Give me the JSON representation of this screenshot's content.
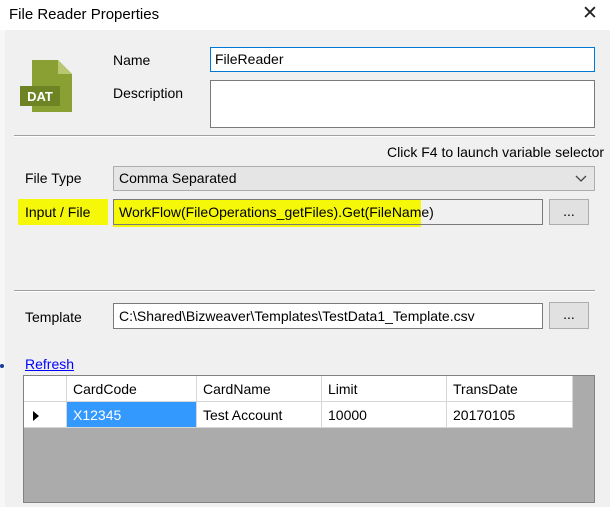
{
  "window": {
    "title": "File Reader Properties"
  },
  "icon": {
    "name": "dat-file-icon",
    "label": "DAT",
    "color": "#8aa033"
  },
  "fields": {
    "name_label": "Name",
    "name_value": "FileReader",
    "description_label": "Description",
    "description_value": ""
  },
  "hint": "Click F4 to launch variable selector",
  "file_type": {
    "label": "File Type",
    "value": "Comma Separated"
  },
  "input_file": {
    "label": "Input / File",
    "value": "WorkFlow(FileOperations_getFiles).Get(FileName)",
    "browse_label": "..."
  },
  "template": {
    "label": "Template",
    "value": "C:\\Shared\\Bizweaver\\Templates\\TestData1_Template.csv",
    "browse_label": "..."
  },
  "refresh_label": "Refresh",
  "grid": {
    "columns": [
      "CardCode",
      "CardName",
      "Limit",
      "TransDate"
    ],
    "rows": [
      [
        "X12345",
        "Test Account",
        "10000",
        "20170105"
      ]
    ]
  },
  "colors": {
    "highlight": "#f6f80a",
    "selection": "#3399ff",
    "link": "#0000ff"
  }
}
